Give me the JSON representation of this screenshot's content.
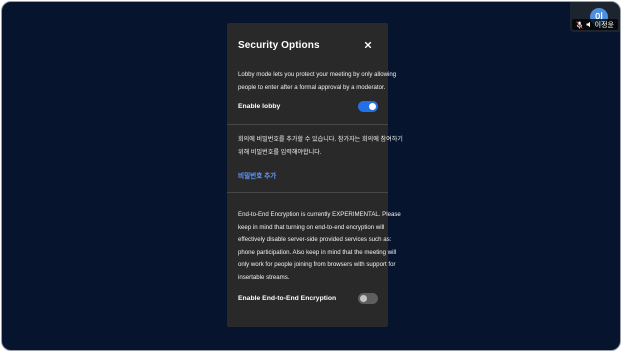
{
  "self_view": {
    "avatar_initials": "이",
    "name": "이정윤"
  },
  "security_dialog": {
    "title": "Security Options",
    "lobby": {
      "description": "Lobby mode lets you protect your meeting by only allowing people to enter after a formal approval by a moderator.",
      "toggle_label": "Enable lobby",
      "enabled": true
    },
    "password": {
      "description": "회의에 비밀번호를 추가할 수 있습니다. 참가자는 회의에 참여하기 위해 비밀번호를 입력해야합니다.",
      "add_link": "비밀번호 추가"
    },
    "e2ee": {
      "description": "End-to-End Encryption is currently EXPERIMENTAL. Please keep in mind that turning on end-to-end encryption will effectively disable server-side provided services such as: phone participation. Also keep in mind that the meeting will only work for people joining from browsers with support for insertable streams.",
      "toggle_label": "Enable End-to-End Encryption",
      "enabled": false
    }
  },
  "colors": {
    "stage_background": "#07142e",
    "dialog_background": "#292929",
    "toggle_on": "#246fe5",
    "link": "#669aff"
  },
  "icons": {
    "close": "close-icon",
    "mic": "mic-muted-icon",
    "audio": "audio-level-icon"
  }
}
